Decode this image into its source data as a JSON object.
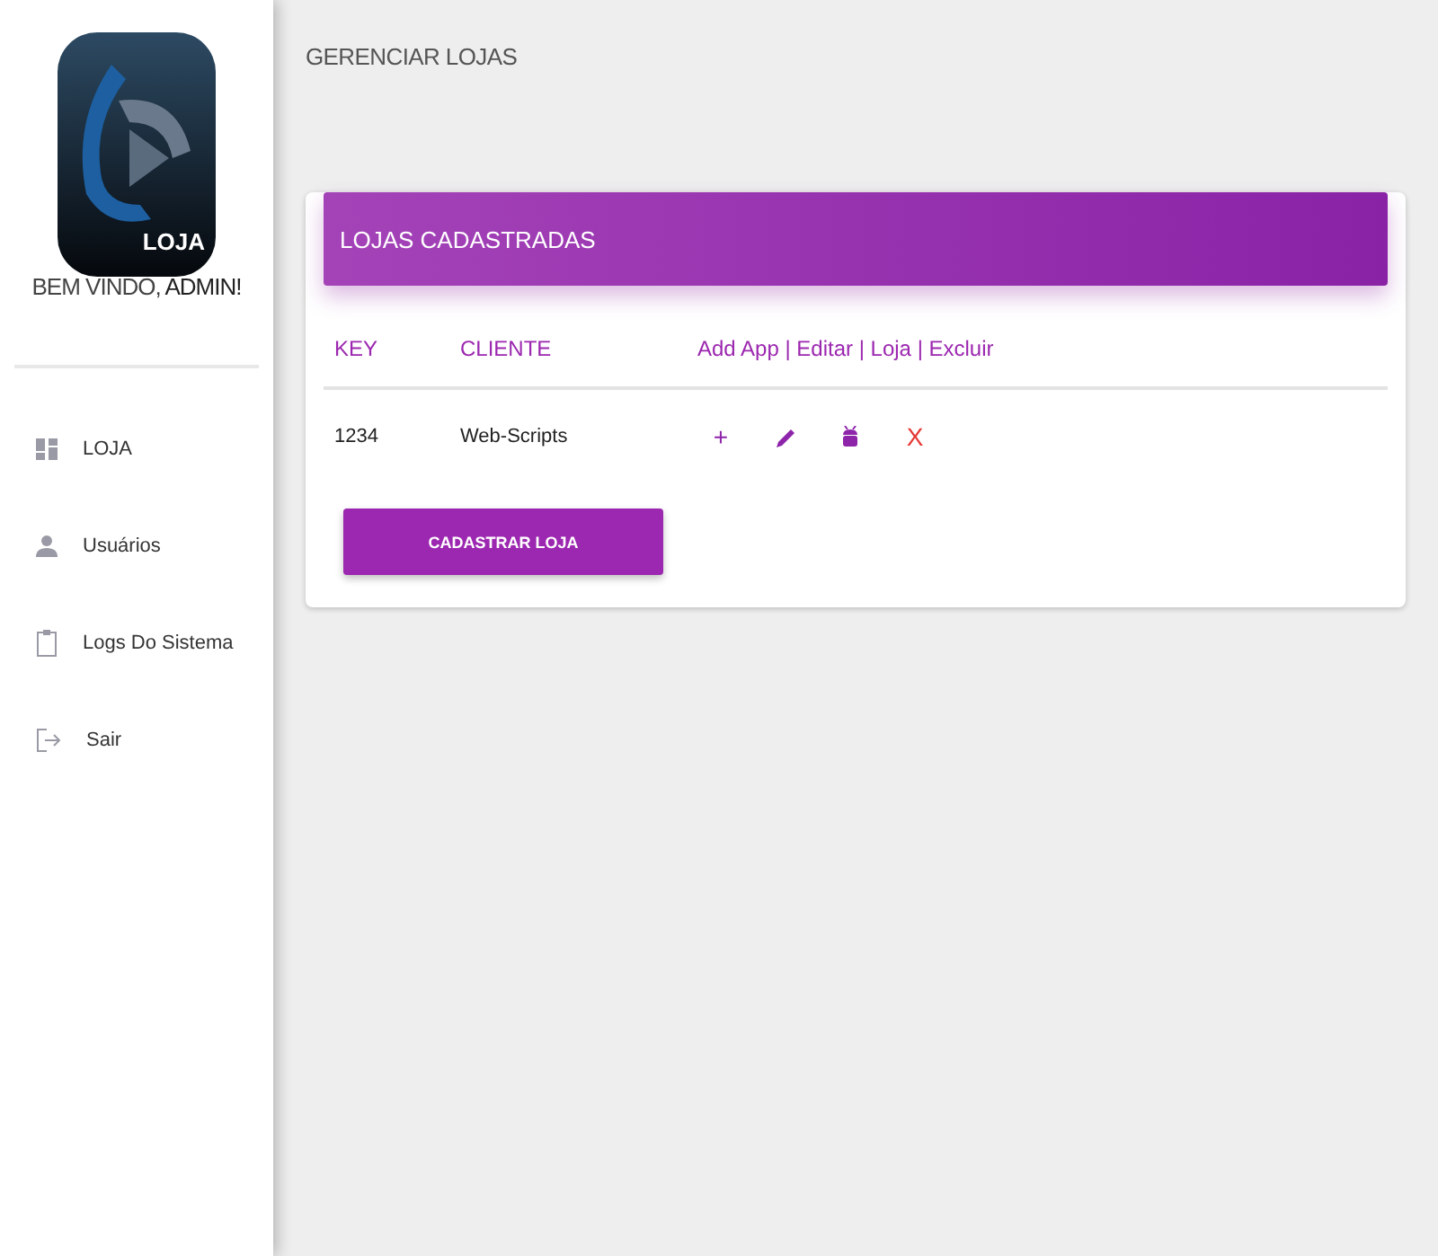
{
  "sidebar": {
    "logo_text": "LOJA",
    "welcome": {
      "text": "BEM VINDO,",
      "user": "ADMIN!"
    },
    "items": [
      {
        "kind": "dashboard",
        "label": "LOJA"
      },
      {
        "kind": "user",
        "label": "Usuários"
      },
      {
        "kind": "clipboard",
        "label": "Logs Do Sistema"
      },
      {
        "kind": "logout",
        "label": "Sair"
      }
    ]
  },
  "page_title": "GERENCIAR LOJAS",
  "card": {
    "title": "LOJAS CADASTRADAS",
    "table": {
      "columns": [
        "KEY",
        "CLIENTE",
        "Add App | Editar | Loja | Excluir"
      ],
      "rows": [
        {
          "key": "1234",
          "cliente": "Web-Scripts",
          "actions": [
            {
              "kind": "add",
              "text": "+"
            },
            {
              "kind": "edit"
            },
            {
              "kind": "android"
            },
            {
              "kind": "delete",
              "text": "X"
            }
          ]
        }
      ]
    },
    "button": "CADASTRAR LOJA"
  }
}
